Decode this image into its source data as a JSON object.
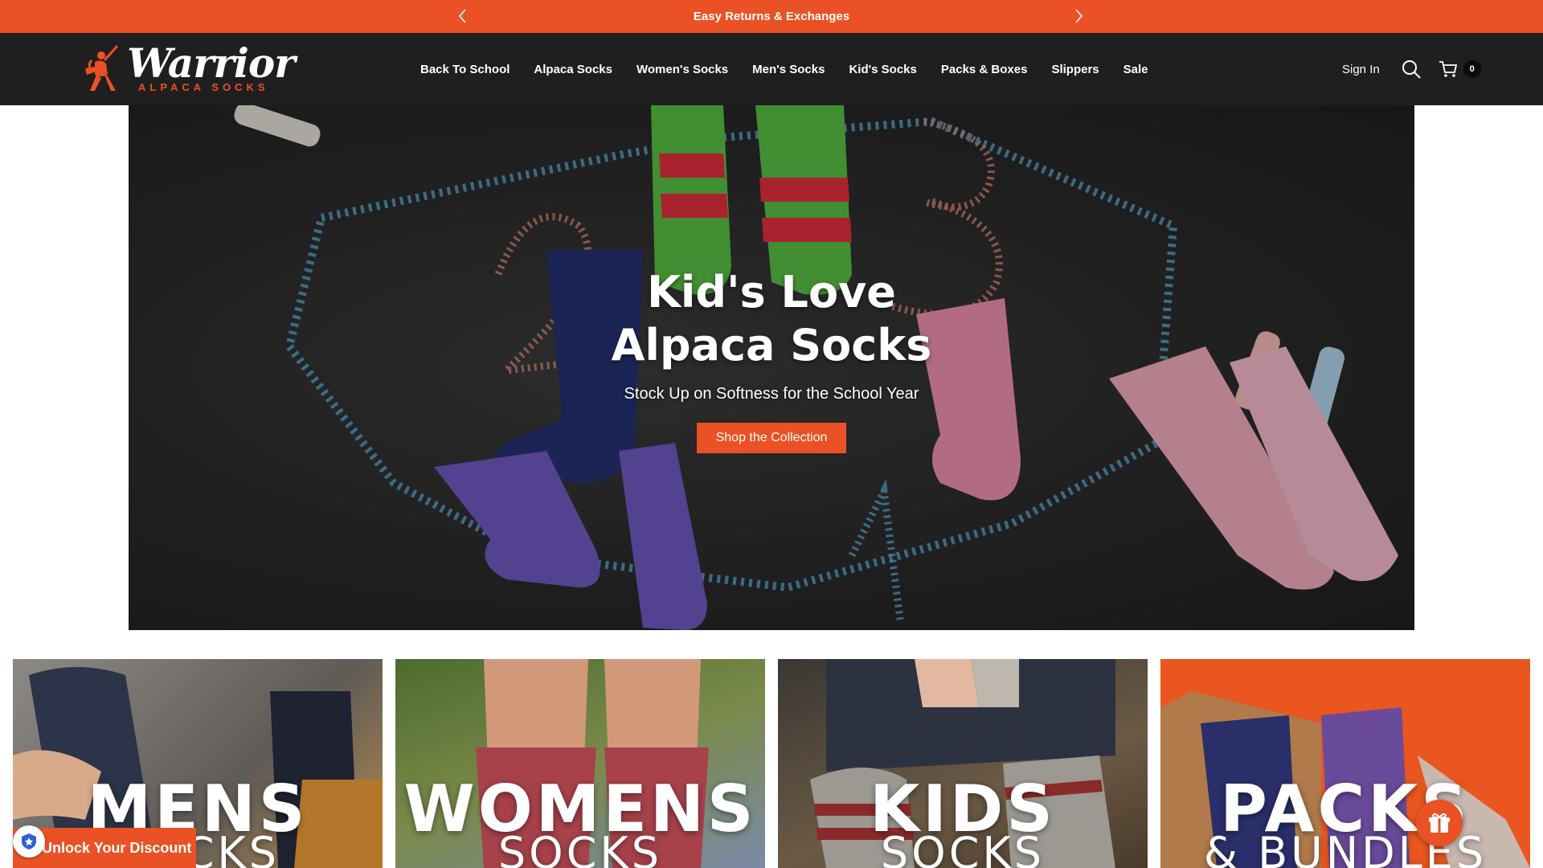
{
  "announcement": {
    "message": "Easy Returns & Exchanges",
    "prev_icon": "chevron-left-icon",
    "next_icon": "chevron-right-icon"
  },
  "brand": {
    "name": "Warrior",
    "tagline": "ALPACA SOCKS",
    "accent_color": "#ea5124",
    "header_bg": "#1f1f1f"
  },
  "nav": {
    "items": [
      {
        "label": "Back To School"
      },
      {
        "label": "Alpaca Socks"
      },
      {
        "label": "Women's Socks"
      },
      {
        "label": "Men's Socks"
      },
      {
        "label": "Kid's Socks"
      },
      {
        "label": "Packs & Boxes"
      },
      {
        "label": "Slippers"
      },
      {
        "label": "Sale"
      }
    ]
  },
  "account": {
    "signin_label": "Sign In",
    "search_icon": "search-icon",
    "cart_icon": "cart-icon",
    "cart_count": "0"
  },
  "hero": {
    "title": "Kid's Love Alpaca Socks",
    "subtitle": "Stock Up on Softness for the School Year",
    "cta_label": "Shop the Collection"
  },
  "categories": [
    {
      "big": "MENS",
      "small": "SOCKS",
      "bg": "#6e6a64"
    },
    {
      "big": "WOMENS",
      "small": "SOCKS",
      "bg": "#5e6b3a"
    },
    {
      "big": "KIDS",
      "small": "SOCKS",
      "bg": "#5a544c"
    },
    {
      "big": "PACKS",
      "small": "& BUNDLES",
      "bg": "#ea5124"
    }
  ],
  "widgets": {
    "discount_label": "Unlock Your Discount",
    "gift_icon": "gift-icon"
  }
}
